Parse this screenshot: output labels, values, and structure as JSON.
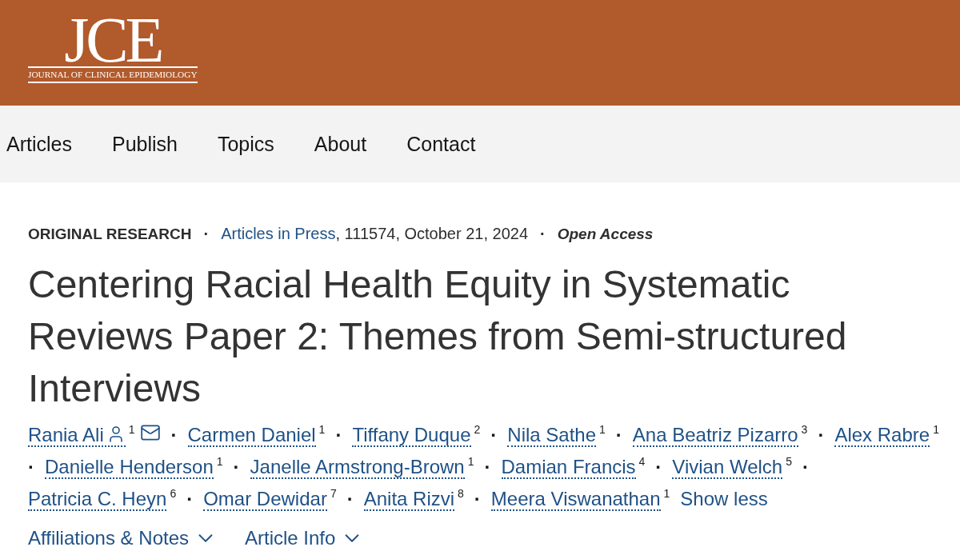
{
  "header": {
    "logo": {
      "mark": "JCE",
      "name": "JOURNAL OF CLINICAL EPIDEMIOLOGY"
    }
  },
  "nav": {
    "items": [
      {
        "label": "Articles"
      },
      {
        "label": "Publish"
      },
      {
        "label": "Topics"
      },
      {
        "label": "About"
      },
      {
        "label": "Contact"
      }
    ]
  },
  "article": {
    "meta": [
      {
        "kind": "category",
        "text": "ORIGINAL RESEARCH"
      },
      {
        "kind": "separator",
        "text": "·"
      },
      {
        "kind": "link",
        "text": "Articles in Press"
      },
      {
        "kind": "plain",
        "text": ", 111574, October 21, 2024"
      },
      {
        "kind": "separator",
        "text": "·"
      },
      {
        "kind": "access",
        "text": "Open Access"
      }
    ],
    "title": "Centering Racial Health Equity in Systematic Reviews Paper 2: Themes from Semi-structured Interviews",
    "authors": [
      {
        "name": "Rania Ali",
        "affiliation": "1",
        "corresponding": true,
        "email": true
      },
      {
        "separator": "·",
        "name": "Carmen Daniel",
        "affiliation": "1",
        "corresponding": false,
        "email": false
      },
      {
        "separator": "·",
        "name": "Tiffany Duque",
        "affiliation": "2",
        "corresponding": false,
        "email": false
      },
      {
        "separator": "·",
        "name": "Nila Sathe",
        "affiliation": "1",
        "corresponding": false,
        "email": false
      },
      {
        "separator": "·",
        "name": "Ana Beatriz Pizarro",
        "affiliation": "3",
        "corresponding": false,
        "email": false
      },
      {
        "separator": "·",
        "name": "Alex Rabre",
        "affiliation": "1",
        "corresponding": false,
        "email": false
      },
      {
        "separator": "·",
        "name": "Danielle Henderson",
        "affiliation": "1",
        "corresponding": false,
        "email": false
      },
      {
        "separator": "·",
        "name": "Janelle Armstrong-Brown",
        "affiliation": "1",
        "corresponding": false,
        "email": false
      },
      {
        "separator": "·",
        "name": "Damian Francis",
        "affiliation": "4",
        "corresponding": false,
        "email": false
      },
      {
        "separator": "·",
        "name": "Vivian Welch",
        "affiliation": "5",
        "corresponding": false,
        "email": false
      },
      {
        "separator": "·",
        "name": "Patricia C. Heyn",
        "affiliation": "6",
        "corresponding": false,
        "email": false
      },
      {
        "separator": "·",
        "name": "Omar Dewidar",
        "affiliation": "7",
        "corresponding": false,
        "email": false
      },
      {
        "separator": "·",
        "name": "Anita Rizvi",
        "affiliation": "8",
        "corresponding": false,
        "email": false
      },
      {
        "separator": "·",
        "name": "Meera Viswanathan",
        "affiliation": "1",
        "corresponding": false,
        "email": false
      }
    ],
    "show_less": "Show less",
    "sections": [
      {
        "label": "Affiliations & Notes",
        "expanded": false
      },
      {
        "label": "Article Info",
        "expanded": false
      }
    ]
  }
}
